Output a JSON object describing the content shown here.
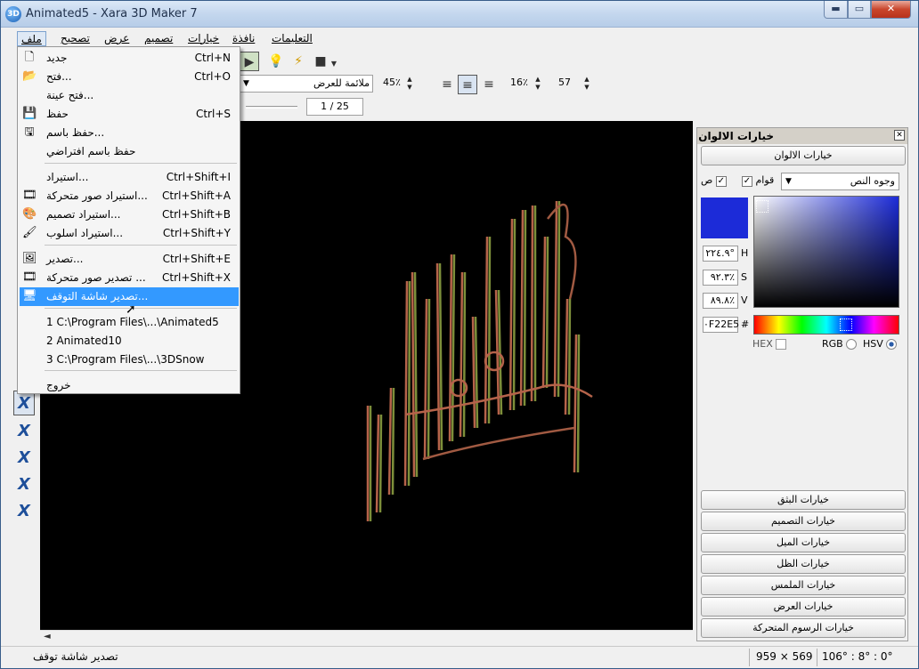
{
  "window": {
    "title": "Animated5 - Xara 3D Maker 7",
    "minimize": "▬",
    "maximize": "▭",
    "close": "✕"
  },
  "menubar": {
    "items": [
      "ملف",
      "تصحيح",
      "عرض",
      "تصميم",
      "خيارات",
      "نافذة",
      "التعليمات"
    ]
  },
  "toolbar": {
    "font_name": "ملائمة للعرض",
    "size1": "45٪",
    "size2": "16٪",
    "size3": "57",
    "frame_counter": "1 / 25"
  },
  "file_menu": {
    "items": [
      {
        "label": "جديد",
        "shortcut": "Ctrl+N",
        "icon": "new-file-icon",
        "glyph": "🗋"
      },
      {
        "label": "فتح...",
        "shortcut": "Ctrl+O",
        "icon": "open-folder-icon",
        "glyph": "📂"
      },
      {
        "label": "فتح عينة...",
        "shortcut": "",
        "icon": "",
        "glyph": ""
      },
      {
        "label": "حفظ",
        "shortcut": "Ctrl+S",
        "icon": "save-icon",
        "glyph": "💾"
      },
      {
        "label": "حفظ باسم...",
        "shortcut": "",
        "icon": "save-as-icon",
        "glyph": "🖫"
      },
      {
        "label": "حفظ باسم افتراضي",
        "shortcut": "",
        "icon": "",
        "glyph": ""
      },
      {
        "label": "استيراد...",
        "shortcut": "Ctrl+Shift+I",
        "icon": "",
        "glyph": ""
      },
      {
        "label": "استيراد صور متحركة...",
        "shortcut": "Ctrl+Shift+A",
        "icon": "import-animation-icon",
        "glyph": "🎞"
      },
      {
        "label": "استيراد تصميم...",
        "shortcut": "Ctrl+Shift+B",
        "icon": "import-design-icon",
        "glyph": "🎨"
      },
      {
        "label": "استيراد اسلوب...",
        "shortcut": "Ctrl+Shift+Y",
        "icon": "import-style-icon",
        "glyph": "🖌"
      },
      {
        "label": "تصدير...",
        "shortcut": "Ctrl+Shift+E",
        "icon": "export-icon",
        "glyph": "🖼"
      },
      {
        "label": "تصدير صور متحركة ...",
        "shortcut": "Ctrl+Shift+X",
        "icon": "export-animation-icon",
        "glyph": "🎞"
      },
      {
        "label": "تصدير شاشة التوقف...",
        "shortcut": "",
        "icon": "export-screensaver-icon",
        "glyph": "🖥"
      },
      {
        "label": "1 C:\\Program Files\\...\\Animated5",
        "shortcut": "",
        "icon": "",
        "glyph": ""
      },
      {
        "label": "2 Animated10",
        "shortcut": "",
        "icon": "",
        "glyph": ""
      },
      {
        "label": "3 C:\\Program Files\\...\\3DSnow",
        "shortcut": "",
        "icon": "",
        "glyph": ""
      },
      {
        "label": "خروج",
        "shortcut": "",
        "icon": "",
        "glyph": ""
      }
    ]
  },
  "color_panel": {
    "title": "خيارات الالوان",
    "section_button": "خيارات الالوان",
    "checkbox_body": "قوام",
    "checkbox_ص": "ص",
    "dropdown": "وجوه النص",
    "h_value": "٢٢٤.٩°",
    "s_value": "٩٢.٣٪",
    "v_value": "٨٩.٨٪",
    "h_label": "H",
    "s_label": "S",
    "v_label": "V",
    "hex_value": "٠F22E5",
    "hash": "#",
    "hex_mode": "HEX",
    "rgb_mode": "RGB",
    "hsv_mode": "HSV",
    "swatch_color": "#1c2bd8"
  },
  "option_buttons": [
    "خيارات البثق",
    "خيارات التصميم",
    "خيارات الميل",
    "خيارات الظل",
    "خيارات الملمس",
    "خيارات العرض",
    "خيارات الرسوم المتحركة"
  ],
  "status": {
    "text": "تصدير شاشة توقف",
    "size": "959 × 569",
    "angles": "106° : 8° : 0°"
  }
}
